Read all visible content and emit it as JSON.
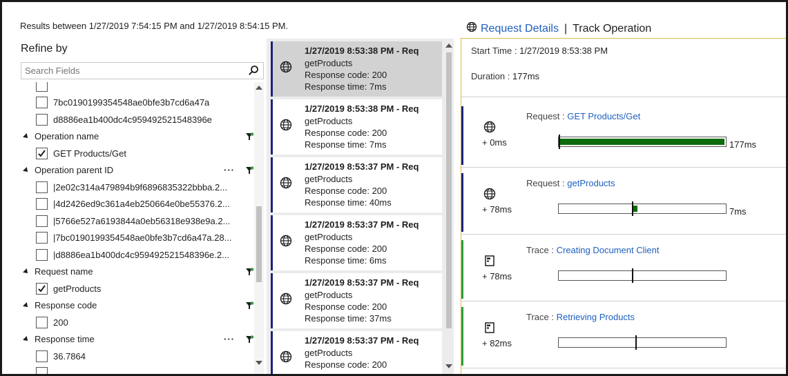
{
  "header": {
    "results_text": "Results between 1/27/2019 7:54:15 PM and 1/27/2019 8:54:15 PM.",
    "details_tab_label": "Request Details",
    "separator": "|",
    "track_tab_label": "Track Operation"
  },
  "refine": {
    "title": "Refine by",
    "search_placeholder": "Search Fields",
    "items": [
      {
        "kind": "value",
        "label": "",
        "checked": false
      },
      {
        "kind": "value",
        "label": "7bc0190199354548ae0bfe3b7cd6a47a",
        "checked": false
      },
      {
        "kind": "value",
        "label": "d8886ea1b400dc4c959492521548396e",
        "checked": false
      },
      {
        "kind": "group",
        "label": "Operation name",
        "ellipsis": false
      },
      {
        "kind": "value",
        "label": "GET Products/Get",
        "checked": true
      },
      {
        "kind": "group",
        "label": "Operation parent ID",
        "ellipsis": true
      },
      {
        "kind": "value",
        "label": "|2e02c314a479894b9f6896835322bbba.2...",
        "checked": false
      },
      {
        "kind": "value",
        "label": "|4d2426ed9c361a4eb250664e0be55376.2...",
        "checked": false
      },
      {
        "kind": "value",
        "label": "|5766e527a6193844a0eb56318e938e9a.2...",
        "checked": false
      },
      {
        "kind": "value",
        "label": "|7bc0190199354548ae0bfe3b7cd6a47a.28...",
        "checked": false
      },
      {
        "kind": "value",
        "label": "|d8886ea1b400dc4c959492521548396e.2...",
        "checked": false
      },
      {
        "kind": "group",
        "label": "Request name",
        "ellipsis": false
      },
      {
        "kind": "value",
        "label": "getProducts",
        "checked": true
      },
      {
        "kind": "group",
        "label": "Response code",
        "ellipsis": false
      },
      {
        "kind": "value",
        "label": "200",
        "checked": false
      },
      {
        "kind": "group",
        "label": "Response time",
        "ellipsis": true
      },
      {
        "kind": "value",
        "label": "36.7864",
        "checked": false
      },
      {
        "kind": "value",
        "label": "",
        "checked": false
      }
    ]
  },
  "requests": [
    {
      "title": "1/27/2019 8:53:38 PM - Req",
      "name": "getProducts",
      "code": "Response code: 200",
      "time": "Response time: 7ms",
      "selected": true
    },
    {
      "title": "1/27/2019 8:53:38 PM - Req",
      "name": "getProducts",
      "code": "Response code: 200",
      "time": "Response time: 7ms",
      "selected": false
    },
    {
      "title": "1/27/2019 8:53:37 PM - Req",
      "name": "getProducts",
      "code": "Response code: 200",
      "time": "Response time: 40ms",
      "selected": false
    },
    {
      "title": "1/27/2019 8:53:37 PM - Req",
      "name": "getProducts",
      "code": "Response code: 200",
      "time": "Response time: 6ms",
      "selected": false
    },
    {
      "title": "1/27/2019 8:53:37 PM - Req",
      "name": "getProducts",
      "code": "Response code: 200",
      "time": "Response time: 37ms",
      "selected": false
    },
    {
      "title": "1/27/2019 8:53:37 PM - Req",
      "name": "getProducts",
      "code": "Response code: 200",
      "time": "",
      "selected": false
    }
  ],
  "details": {
    "start_time_key": "Start Time :",
    "start_time_value": "1/27/2019 8:53:38 PM",
    "duration_key": "Duration :",
    "duration_value": "177ms",
    "operations": [
      {
        "type_label": "Request :",
        "link": "GET Products/Get",
        "offset": "+ 0ms",
        "icon": "globe-icon",
        "color": "#1a237e",
        "start_frac": 0.0,
        "fill_frac": 1.0,
        "duration": "177ms"
      },
      {
        "type_label": "Request :",
        "link": "getProducts",
        "offset": "+ 78ms",
        "icon": "globe-icon",
        "color": "#1a237e",
        "start_frac": 0.44,
        "fill_frac": 0.04,
        "duration": "7ms"
      },
      {
        "type_label": "Trace :",
        "link": "Creating Document Client",
        "offset": "+ 78ms",
        "icon": "document-icon",
        "color": "#2e9e3e",
        "start_frac": 0.44,
        "fill_frac": 0.0,
        "duration": ""
      },
      {
        "type_label": "Trace :",
        "link": "Retrieving Products",
        "offset": "+ 82ms",
        "icon": "document-icon",
        "color": "#2e9e3e",
        "start_frac": 0.46,
        "fill_frac": 0.0,
        "duration": ""
      }
    ]
  }
}
